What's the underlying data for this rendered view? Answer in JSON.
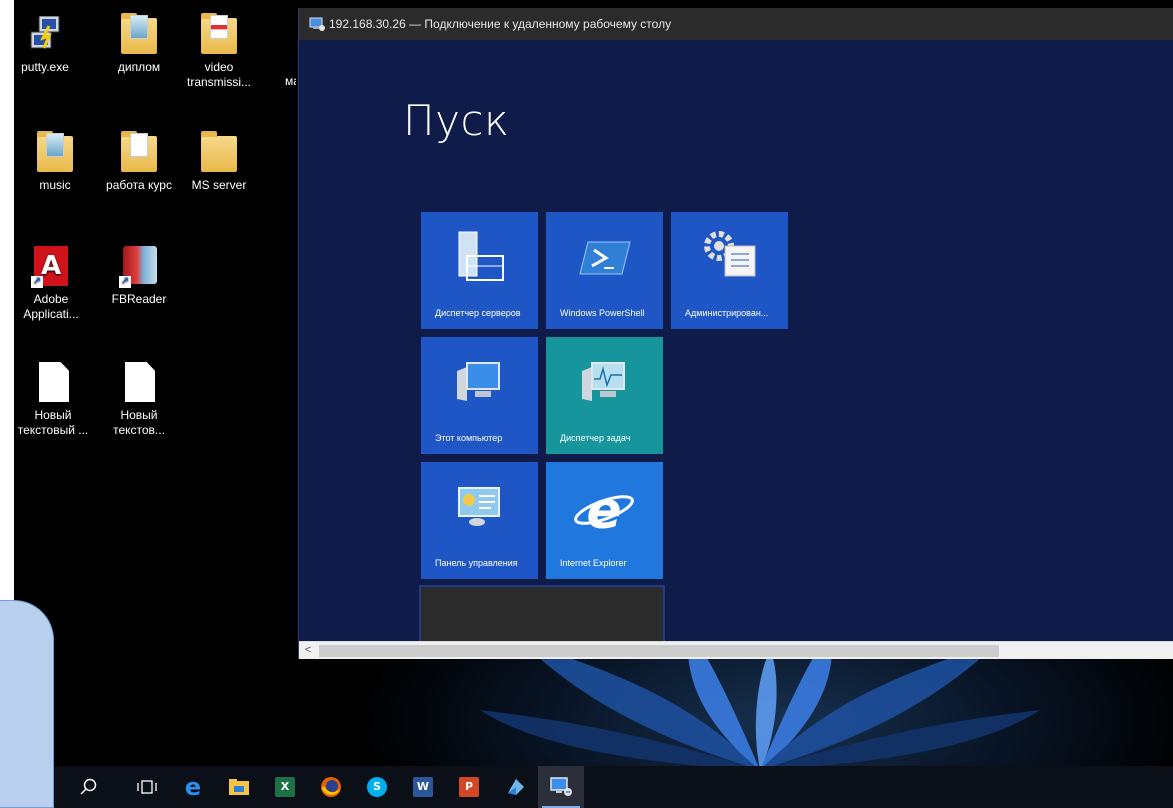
{
  "desktop": {
    "icons": [
      {
        "label": "putty.exe"
      },
      {
        "label": "диплом"
      },
      {
        "label": "video transmissi..."
      },
      {
        "label": "ма"
      },
      {
        "label": "music"
      },
      {
        "label": "работа курс"
      },
      {
        "label": "MS server"
      },
      {
        "label": "Adobe Applicati..."
      },
      {
        "label": "FBReader"
      },
      {
        "label": "Новый текстовый ..."
      },
      {
        "label": "Новый текстов..."
      }
    ]
  },
  "rdp_window": {
    "title": "192.168.30.26 — Подключение к удаленному рабочему столу",
    "start_heading": "Пуск",
    "tiles": [
      {
        "label": "Диспетчер серверов",
        "icon": "server-manager-icon",
        "color": "#1f56c5"
      },
      {
        "label": "Windows PowerShell",
        "icon": "powershell-icon",
        "color": "#1f56c5"
      },
      {
        "label": "Администрирован...",
        "icon": "admin-tools-icon",
        "color": "#1f56c5"
      },
      {
        "label": "Этот компьютер",
        "icon": "computer-icon",
        "color": "#1f56c5"
      },
      {
        "label": "Диспетчер задач",
        "icon": "task-manager-icon",
        "color": "#16969c"
      },
      {
        "label": "Панель управления",
        "icon": "control-panel-icon",
        "color": "#1f56c5"
      },
      {
        "label": "Internet Explorer",
        "icon": "internet-explorer-icon",
        "color": "#2077de"
      }
    ],
    "scroll_left_arrow": "<"
  },
  "taskbar": {
    "items": [
      "search-icon",
      "task-view-icon",
      "edge-icon",
      "file-explorer-icon",
      "excel-icon",
      "firefox-icon",
      "skype-icon",
      "word-icon",
      "powerpoint-icon",
      "app-icon",
      "remote-desktop-icon"
    ],
    "excel_letter": "X",
    "word_letter": "W",
    "ppt_letter": "P",
    "skype_letter": "S"
  }
}
